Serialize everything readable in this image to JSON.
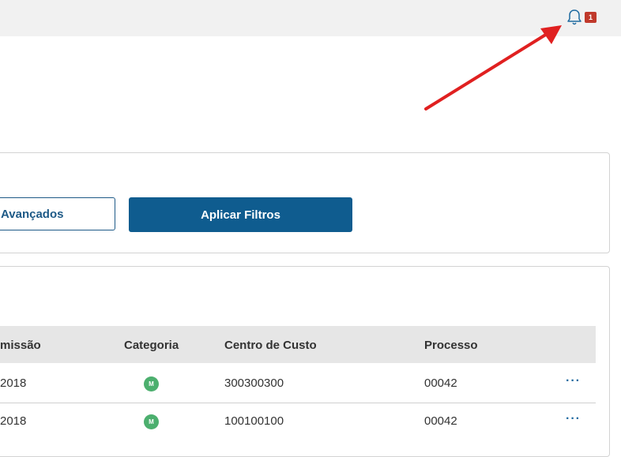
{
  "header": {
    "notification_count": "1",
    "bell_icon": "bell-icon"
  },
  "filters": {
    "advanced_label": "Avançados",
    "apply_label": "Aplicar Filtros"
  },
  "table": {
    "columns": [
      "missão",
      "Categoria",
      "Centro de Custo",
      "Processo"
    ],
    "rows": [
      {
        "date": "2018",
        "category": "M",
        "cost_center": "300300300",
        "process": "00042",
        "more": "···"
      },
      {
        "date": "2018",
        "category": "M",
        "cost_center": "100100100",
        "process": "00042",
        "more": "···"
      }
    ]
  },
  "colors": {
    "primary": "#0f5c8f",
    "accent_badge": "#c0392b",
    "category_green": "#4caf6e",
    "arrow": "#e02020"
  }
}
